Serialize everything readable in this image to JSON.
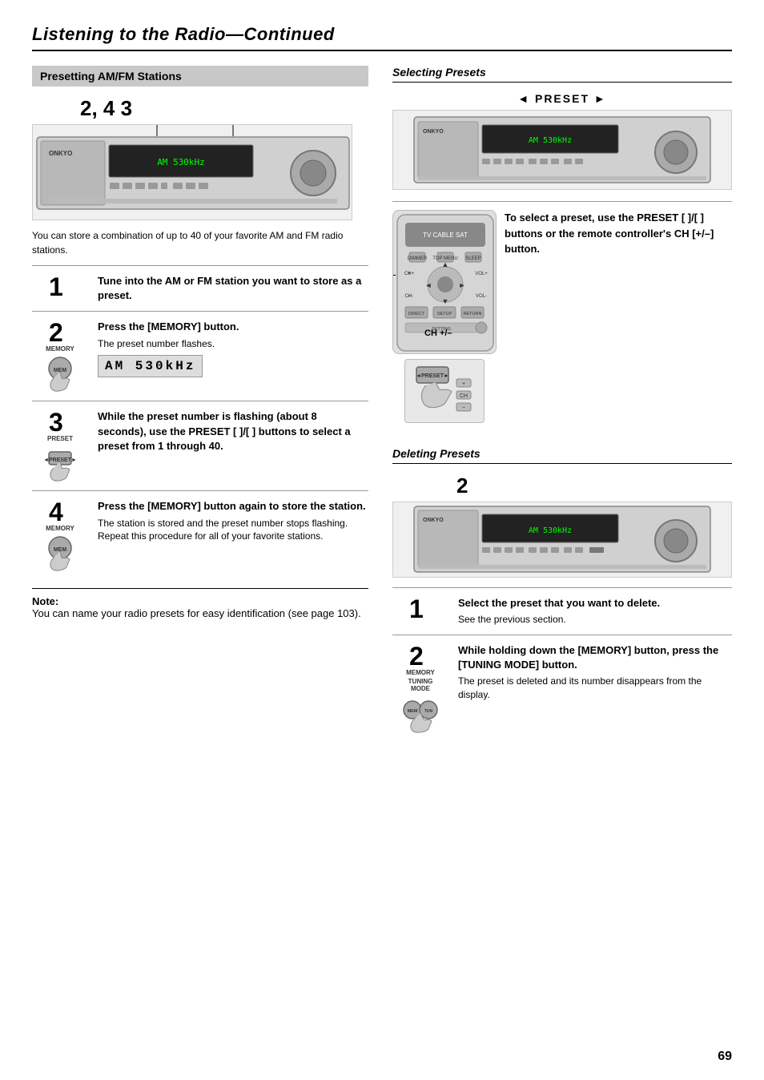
{
  "header": {
    "title": "Listening to the Radio",
    "subtitle": "Continued"
  },
  "left_section": {
    "title": "Presetting AM/FM Stations",
    "step_numbers_top": "2, 4   3",
    "intro_text": "You can store a combination of up to 40 of your favorite AM and FM radio stations.",
    "steps": [
      {
        "number": "1",
        "bold_text": "Tune into the AM or FM station you want to store as a preset.",
        "normal_text": "",
        "icon_label": ""
      },
      {
        "number": "2",
        "bold_text": "Press the [MEMORY] button.",
        "normal_text": "The preset number flashes.",
        "icon_label": "MEMORY",
        "freq_display": "AM   530kHz"
      },
      {
        "number": "3",
        "bold_text": "While the preset number is flashing (about 8 seconds), use the PRESET [ ]/[ ] buttons to select a preset from 1 through 40.",
        "normal_text": "",
        "icon_label": "PRESET"
      },
      {
        "number": "4",
        "bold_text": "Press the [MEMORY] button again to store the station.",
        "normal_text": "The station is stored and the preset number stops flashing.\nRepeat this procedure for all of your favorite stations.",
        "icon_label": "MEMORY"
      }
    ],
    "note": {
      "title": "Note:",
      "text": "You can name your radio presets for easy identification (see page 103)."
    }
  },
  "right_section": {
    "selecting_presets": {
      "title": "Selecting Presets",
      "preset_label": "◄ PRESET ►",
      "description": "To select a preset, use the PRESET [ ]/[ ] buttons or the remote controller's CH [+/–] button.",
      "ch_label": "CH +/–"
    },
    "deleting_presets": {
      "title": "Deleting Presets",
      "step_number_top": "2",
      "steps": [
        {
          "number": "1",
          "bold_text": "Select the preset that you want to delete.",
          "normal_text": "See the previous section."
        },
        {
          "number": "2",
          "bold_text": "While holding down the [MEMORY] button, press the [TUNING MODE] button.",
          "normal_text": "The preset is deleted and its number disappears from the display.",
          "icon_label1": "MEMORY",
          "icon_label2": "TUNING MODE"
        }
      ]
    }
  },
  "page_number": "69"
}
